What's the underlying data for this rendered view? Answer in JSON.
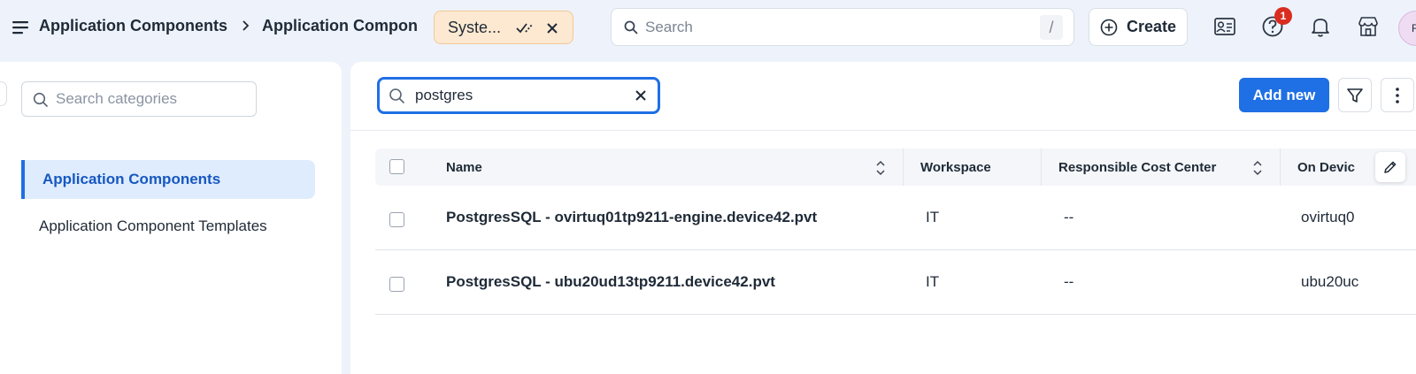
{
  "header": {
    "breadcrumb_1": "Application Components",
    "breadcrumb_2": "Application Compon",
    "chip_label": "Syste...",
    "search_placeholder": "Search",
    "search_shortcut": "/",
    "create_label": "Create",
    "notification_count": "1",
    "avatar_initial": "R"
  },
  "sidebar": {
    "search_placeholder": "Search categories",
    "items": [
      {
        "label": "Application Components",
        "active": true
      },
      {
        "label": "Application Component Templates",
        "active": false
      }
    ]
  },
  "main": {
    "search_value": "postgres",
    "add_new_label": "Add new",
    "columns": [
      "Name",
      "Workspace",
      "Responsible Cost Center",
      "On Devic"
    ],
    "rows": [
      {
        "name": "PostgresSQL - ovirtuq01tp9211-engine.device42.pvt",
        "workspace": "IT",
        "cost_center": "--",
        "device": "ovirtuq0"
      },
      {
        "name": "PostgresSQL - ubu20ud13tp9211.device42.pvt",
        "workspace": "IT",
        "cost_center": "--",
        "device": "ubu20uc"
      }
    ]
  },
  "colors": {
    "accent": "#1f6fe5",
    "chip_bg": "#fde9d1",
    "badge": "#d92d20",
    "page_bg": "#eef3fb"
  }
}
